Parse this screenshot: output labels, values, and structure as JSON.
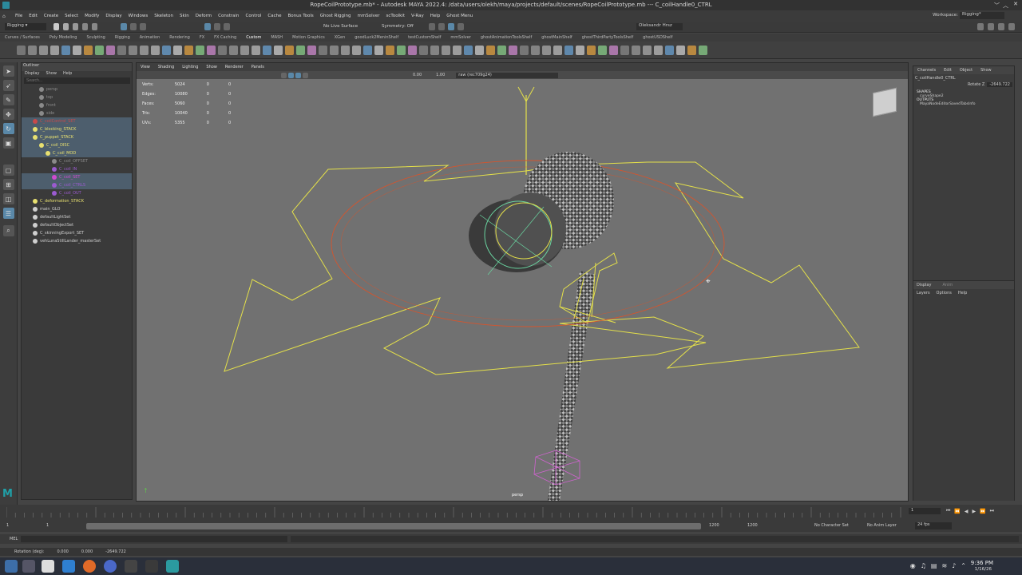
{
  "window": {
    "title": "RopeCoilPrototype.mb* - Autodesk MAYA 2022.4: /data/users/olekh/maya/projects/default/scenes/RopeCoilPrototype.mb --- C_coilHandle0_CTRL"
  },
  "workspace": {
    "label": "Workspace:",
    "value": "Rigging*"
  },
  "menubar": [
    "File",
    "Edit",
    "Create",
    "Select",
    "Modify",
    "Display",
    "Windows",
    "Skeleton",
    "Skin",
    "Deform",
    "Constrain",
    "Control",
    "Cache",
    "Bonus Tools",
    "Ghost Rigging",
    "mmSolver",
    "scToolkit",
    "V-Ray",
    "Help",
    "Ghost Menu"
  ],
  "statusline": {
    "mode": "Rigging",
    "live": "No Live Surface",
    "symmetry": "Symmetry: Off",
    "user": "Oleksandr Hrsz"
  },
  "shelftabs": [
    "Curves / Surfaces",
    "Poly Modeling",
    "Sculpting",
    "Rigging",
    "Animation",
    "Rendering",
    "FX",
    "FX Caching",
    "Custom",
    "MASH",
    "Motion Graphics",
    "XGen",
    "goodLuck2MeninShelf",
    "testCustomShelf",
    "mmSolver",
    "ghostAnimationToolsShelf",
    "ghostMainShelf",
    "ghostThirdPartyToolsShelf",
    "ghostUSDShelf"
  ],
  "active_shelf": "Custom",
  "outliner": {
    "title": "Outliner",
    "menu": [
      "Display",
      "Show",
      "Help"
    ],
    "search_placeholder": "Search...",
    "items": [
      {
        "label": "persp",
        "indent": 1,
        "color": "#8a8a8a"
      },
      {
        "label": "top",
        "indent": 1,
        "color": "#8a8a8a"
      },
      {
        "label": "front",
        "indent": 1,
        "color": "#8a8a8a"
      },
      {
        "label": "side",
        "indent": 1,
        "color": "#8a8a8a"
      },
      {
        "label": "C_coilControl_SET",
        "indent": 0,
        "color": "#c84a4a"
      },
      {
        "label": "C_blocking_STACK",
        "indent": 0,
        "color": "#e8e070"
      },
      {
        "label": "C_puppet_STACK",
        "indent": 0,
        "color": "#e8e070"
      },
      {
        "label": "C_coil_DISC",
        "indent": 1,
        "color": "#e8e070"
      },
      {
        "label": "C_coil_MOD",
        "indent": 2,
        "color": "#e8e070"
      },
      {
        "label": "C_coil_OFFSET",
        "indent": 3,
        "color": "#8a8a8a"
      },
      {
        "label": "C_coil_IN",
        "indent": 3,
        "color": "#9b5bd0"
      },
      {
        "label": "C_coil_SET",
        "indent": 3,
        "color": "#d04ad0"
      },
      {
        "label": "C_coil_CTRLS",
        "indent": 3,
        "color": "#9b5bd0"
      },
      {
        "label": "C_coil_OUT",
        "indent": 3,
        "color": "#9b5bd0"
      },
      {
        "label": "C_deformation_STACK",
        "indent": 0,
        "color": "#e8e070"
      },
      {
        "label": "main_GLO",
        "indent": 0,
        "color": "#cfcfcf"
      },
      {
        "label": "defaultLightSet",
        "indent": 0,
        "color": "#cfcfcf"
      },
      {
        "label": "defaultObjectSet",
        "indent": 0,
        "color": "#cfcfcf"
      },
      {
        "label": "C_skinningExport_SET",
        "indent": 0,
        "color": "#cfcfcf"
      },
      {
        "label": "vehLunaStillLander_masterSet",
        "indent": 0,
        "color": "#cfcfcf"
      }
    ]
  },
  "viewport": {
    "menu": [
      "View",
      "Shading",
      "Lighting",
      "Show",
      "Renderer",
      "Panels"
    ],
    "near": "0.00",
    "far": "1.00",
    "colorspace": "raw (rec709g24)",
    "camera": "persp",
    "hud": [
      {
        "label": "Verts:",
        "a": "5024",
        "b": "0",
        "c": "0"
      },
      {
        "label": "Edges:",
        "a": "10080",
        "b": "0",
        "c": "0"
      },
      {
        "label": "Faces:",
        "a": "5060",
        "b": "0",
        "c": "0"
      },
      {
        "label": "Tris:",
        "a": "10040",
        "b": "0",
        "c": "0"
      },
      {
        "label": "UVs:",
        "a": "5355",
        "b": "0",
        "c": "0"
      }
    ],
    "colors": {
      "control": "#e4e04a",
      "guide": "#d4552e",
      "circle": "#6ad4a0",
      "locator": "#d064d0"
    }
  },
  "channelbox": {
    "menu": [
      "Channels",
      "Edit",
      "Object",
      "Show"
    ],
    "node": "C_coilHandle0_CTRL",
    "attr": "Rotate Z",
    "value": "-2649.722",
    "shapes_label": "SHAPES",
    "shape": "curveShape2",
    "outputs_label": "OUTPUTS",
    "output": "MayaNodeEditorSavedTabsInfo",
    "layer_tabs": [
      "Display",
      "Anim"
    ],
    "layer_menu": [
      "Layers",
      "Options",
      "Help"
    ]
  },
  "timeline": {
    "start": "1",
    "current": "1",
    "range_start": "1",
    "range_end": "1200",
    "range_end2": "1200",
    "end": "1200",
    "character": "No Character Set",
    "anim_layer": "No Anim Layer",
    "fps": "24 fps"
  },
  "cmdline": {
    "lang": "MEL"
  },
  "helpline": {
    "label": "Rotation (deg):",
    "x": "0.000",
    "y": "0.000",
    "z": "-2649.722"
  },
  "taskbar": {
    "time": "9:36 PM",
    "date": "1/16/26"
  }
}
